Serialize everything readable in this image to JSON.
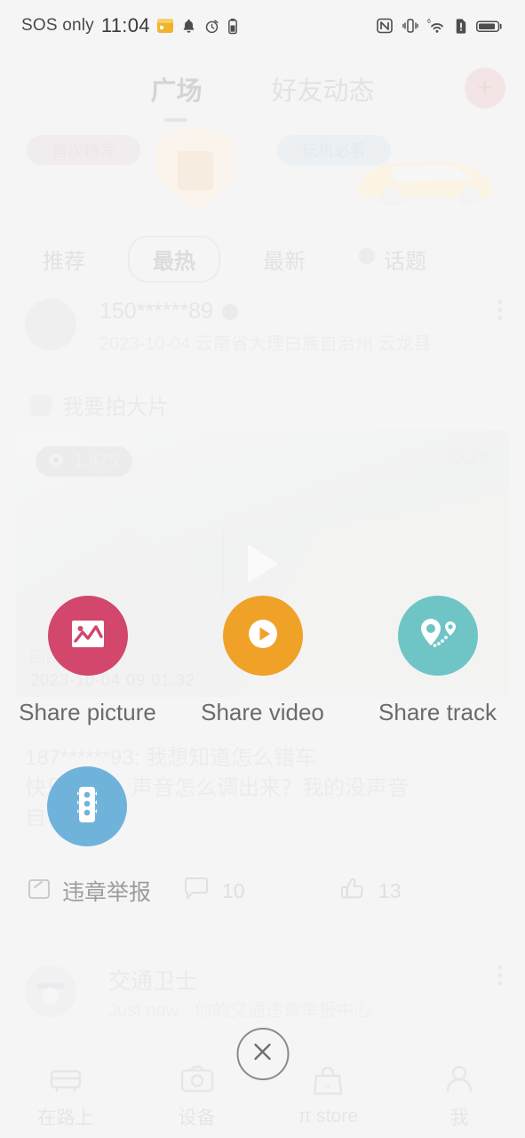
{
  "status_bar": {
    "carrier": "SOS only",
    "time": "11:04",
    "left_icons": [
      "calendar-icon",
      "bell-icon",
      "alarm-clock-icon",
      "battery-saver-icon"
    ],
    "right_icons": [
      "nfc-icon",
      "vibrate-icon",
      "wifi-icon",
      "sim-alert-icon",
      "battery-icon"
    ]
  },
  "top_nav": {
    "tabs": [
      {
        "label": "广场",
        "active": true
      },
      {
        "label": "好友动态",
        "active": false
      }
    ],
    "add_button": "+"
  },
  "banners": {
    "pill_left": "首次特写",
    "pill_right": "玩机必看"
  },
  "filters": {
    "tabs": [
      {
        "label": "推荐",
        "selected": false
      },
      {
        "label": "最热",
        "selected": true
      },
      {
        "label": "最新",
        "selected": false
      }
    ],
    "topic": "话题"
  },
  "post": {
    "username": "150******89",
    "meta": "2023-10-04  云南省大理白族自治州 云龙县",
    "tag_text": "我要拍大片",
    "media": {
      "views": "1,475",
      "duration": "30:29",
      "stamp_line1": "回回车车闪闪",
      "stamp_line2": "2023-10-04 09:01:32"
    },
    "comments": [
      "187******93: 我想知道怎么错车",
      "快乐人生：声音怎么调出来？我的没声音",
      "自"
    ],
    "actions": {
      "report_label": "违章举报",
      "comment_count": "10",
      "like_count": "13"
    }
  },
  "official_card": {
    "name": "交通卫士",
    "subtitle": "Just now · 你的交通违章举报中心"
  },
  "share_sheet": {
    "items": [
      {
        "label": "Share picture",
        "icon": "picture-icon",
        "color": "#d2476b"
      },
      {
        "label": "Share video",
        "icon": "play-icon",
        "color": "#f0a128"
      },
      {
        "label": "Share track",
        "icon": "map-pin-track-icon",
        "color": "#6fc5c5"
      }
    ],
    "extra_action": {
      "label": "traffic-light",
      "icon": "traffic-light-icon",
      "color": "#6fb3db"
    },
    "close_label": "close-icon"
  },
  "bottom_nav": {
    "items": [
      {
        "label": "在路上",
        "icon": "car-icon"
      },
      {
        "label": "设备",
        "icon": "camera-icon"
      },
      {
        "label": "π store",
        "icon": "shop-bag-icon"
      },
      {
        "label": "我",
        "icon": "person-icon"
      }
    ]
  }
}
